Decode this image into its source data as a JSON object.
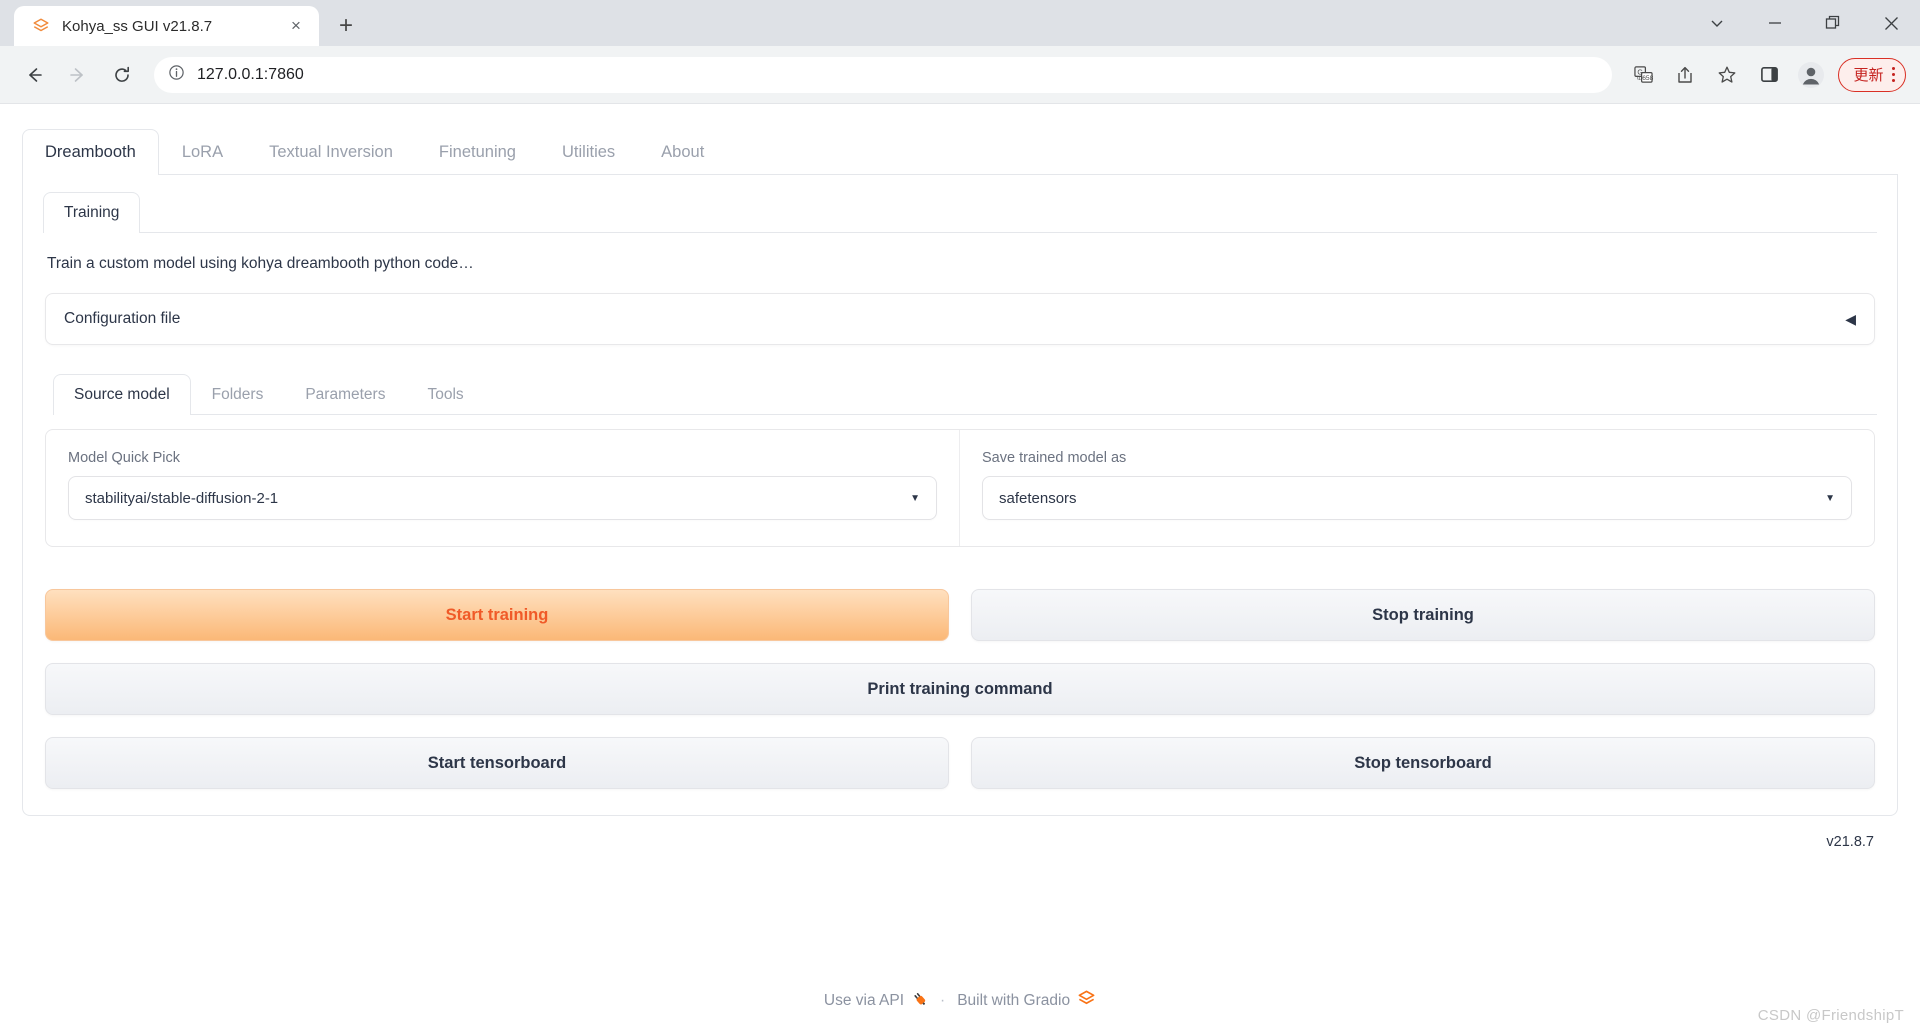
{
  "browser": {
    "tab": {
      "title": "Kohya_ss GUI v21.8.7",
      "favicon_name": "gradio-logo-icon",
      "close_label": "×"
    },
    "new_tab_label": "+",
    "window_controls": {
      "collapse_label": "⌄",
      "minimize_label": "—",
      "maximize_label": "❐",
      "close_label": "✕"
    },
    "nav": {
      "back_label": "←",
      "forward_label": "→",
      "reload_label": "↻"
    },
    "omnibox": {
      "url": "127.0.0.1:7860",
      "info_icon": "info-icon"
    },
    "toolbar_icons": [
      "translate-icon",
      "share-icon",
      "bookmark-star-icon",
      "side-panel-icon",
      "profile-avatar-icon"
    ],
    "update_button": {
      "label": "更新",
      "accent": "#d93025"
    }
  },
  "app": {
    "main_tabs": [
      {
        "label": "Dreambooth",
        "active": true
      },
      {
        "label": "LoRA",
        "active": false
      },
      {
        "label": "Textual Inversion",
        "active": false
      },
      {
        "label": "Finetuning",
        "active": false
      },
      {
        "label": "Utilities",
        "active": false
      },
      {
        "label": "About",
        "active": false
      }
    ],
    "section_tabs": [
      {
        "label": "Training",
        "active": true
      }
    ],
    "description": "Train a custom model using kohya dreambooth python code…",
    "accordion": {
      "label": "Configuration file",
      "arrow": "◀",
      "expanded": false
    },
    "sub_tabs": [
      {
        "label": "Source model",
        "active": true
      },
      {
        "label": "Folders",
        "active": false
      },
      {
        "label": "Parameters",
        "active": false
      },
      {
        "label": "Tools",
        "active": false
      }
    ],
    "fields": {
      "model_quick_pick": {
        "label": "Model Quick Pick",
        "value": "stabilityai/stable-diffusion-2-1",
        "caret": "▼"
      },
      "save_trained_model_as": {
        "label": "Save trained model as",
        "value": "safetensors",
        "caret": "▼"
      }
    },
    "buttons": {
      "start_training": "Start training",
      "stop_training": "Stop training",
      "print_training_command": "Print training command",
      "start_tensorboard": "Start tensorboard",
      "stop_tensorboard": "Stop tensorboard"
    },
    "colors": {
      "primary_button_text": "#f05a28",
      "primary_button_top": "#ffe0bf",
      "primary_button_bottom": "#fbb877",
      "secondary_button_text": "#2d3648"
    },
    "version": "v21.8.7"
  },
  "footer": {
    "use_via_api": "Use via API",
    "api_icon": "plug-icon",
    "separator": "·",
    "built_with": "Built with Gradio",
    "gradio_icon": "gradio-logo-icon"
  },
  "watermark": "CSDN @FriendshipT"
}
